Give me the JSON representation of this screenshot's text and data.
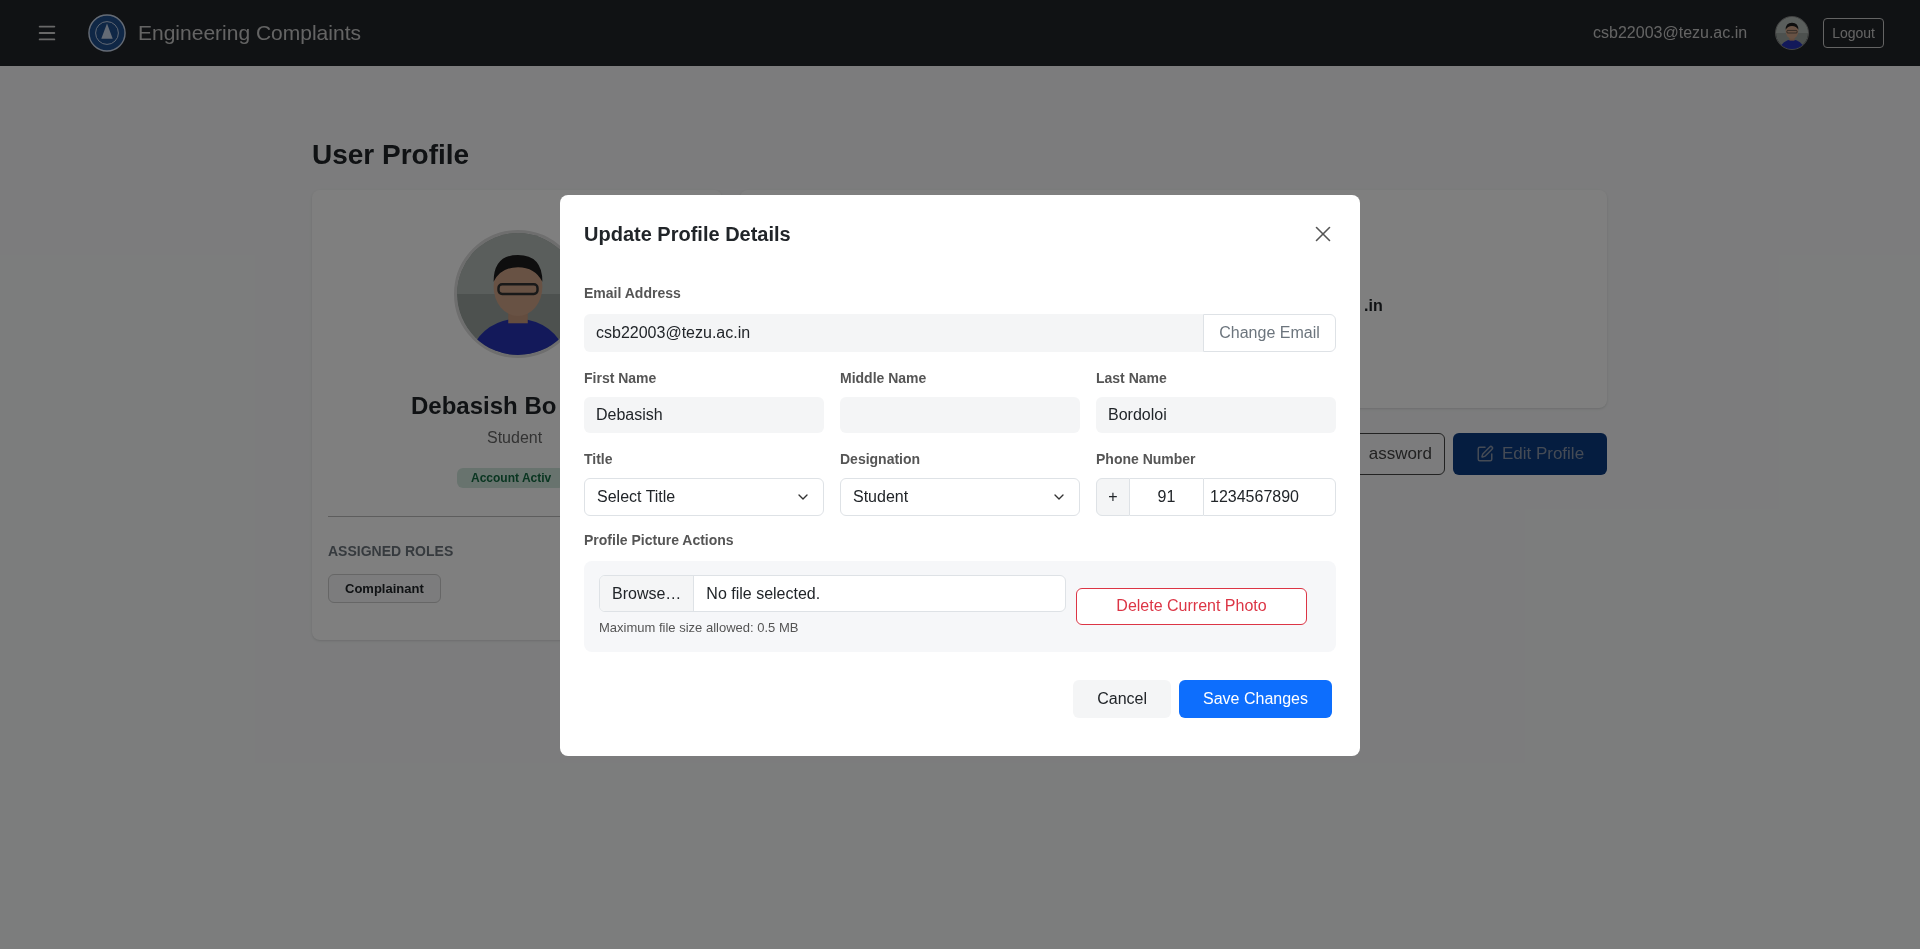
{
  "navbar": {
    "brand": "Engineering Complaints",
    "user_email": "csb22003@tezu.ac.in",
    "logout": "Logout"
  },
  "page": {
    "title": "User Profile",
    "profile_card": {
      "name": "Debasish Bo",
      "role": "Student",
      "status_badge": "Account Activ",
      "roles_heading": "ASSIGNED ROLES",
      "roles": [
        "Complainant"
      ]
    },
    "details_card": {
      "fragment": ".in"
    },
    "actions": [
      {
        "label": "assword",
        "kind": "outline"
      },
      {
        "label": "Edit Profile",
        "kind": "primary"
      }
    ]
  },
  "modal": {
    "title": "Update Profile Details",
    "email": {
      "label": "Email Address",
      "value": "csb22003@tezu.ac.in",
      "button": "Change Email"
    },
    "rows": [
      [
        {
          "kind": "text",
          "label": "First Name",
          "value": "Debasish"
        },
        {
          "kind": "text",
          "label": "Middle Name"
        },
        {
          "kind": "text",
          "label": "Last Name",
          "value": "Bordoloi"
        }
      ],
      [
        {
          "kind": "select",
          "label": "Title",
          "value": "Select Title"
        },
        {
          "kind": "select",
          "label": "Designation",
          "value": "Student"
        },
        {
          "kind": "phone",
          "label": "Phone Number",
          "prefix": "+",
          "code": "91",
          "value": "1234567890"
        }
      ]
    ],
    "picture": {
      "label": "Profile Picture Actions",
      "browse": "Browse…",
      "file_status": "No file selected.",
      "hint": "Maximum file size allowed: 0.5 MB",
      "delete": "Delete Current Photo"
    },
    "footer": [
      {
        "label": "Cancel",
        "kind": "secondary"
      },
      {
        "label": "Save Changes",
        "kind": "primary"
      }
    ]
  }
}
